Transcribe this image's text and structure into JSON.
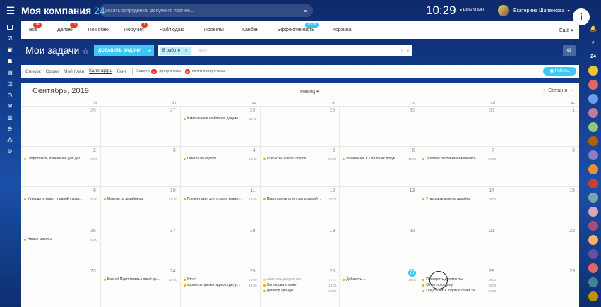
{
  "header": {
    "company": "Моя компания",
    "company_num": "24",
    "search_placeholder": "искать сотрудника, документ, прочее...",
    "time": "10:29",
    "work_status": "РАБОТАЮ",
    "user_name": "Екатерина Шапенкова"
  },
  "nav": {
    "items": [
      {
        "label": "Все",
        "badge": "14"
      },
      {
        "label": "Делаю",
        "badge": "11"
      },
      {
        "label": "Помогаю",
        "badge": ""
      },
      {
        "label": "Поручил",
        "badge": "1"
      },
      {
        "label": "Наблюдаю",
        "badge": ""
      },
      {
        "label": "Проекты",
        "badge": ""
      },
      {
        "label": "Канбан",
        "badge": ""
      },
      {
        "label": "Эффективность",
        "badge": "100%"
      },
      {
        "label": "Корзина",
        "badge": ""
      }
    ],
    "more": "Ещё"
  },
  "page": {
    "title": "Мои задачи",
    "add_task": "ДОБАВИТЬ ЗАДАЧУ",
    "filter_chip": "В работе",
    "filter_placeholder": "поиск"
  },
  "views": {
    "items": [
      "Список",
      "Сроки",
      "Мой план",
      "Календарь",
      "Гант"
    ],
    "active": "Календарь",
    "tasks_label": "Задачи",
    "overdue_count": "11",
    "overdue_label": "просрочены",
    "almost_count": "8",
    "almost_label": "почти просрочены",
    "robots": "Роботы"
  },
  "calendar": {
    "month": "Сентябрь, 2019",
    "mode": "Месяц",
    "today": "Сегодня",
    "days_of_week": [
      "пн",
      "вт",
      "ср",
      "чт",
      "пт",
      "сб",
      "вс"
    ],
    "weeks": [
      {
        "days": [
          {
            "num": "26",
            "other": true,
            "events": []
          },
          {
            "num": "27",
            "other": true,
            "events": []
          },
          {
            "num": "28",
            "other": true,
            "events": [
              {
                "text": "Изменения в шаблонах докуме...",
                "time": "11:00"
              }
            ]
          },
          {
            "num": "29",
            "other": true,
            "events": []
          },
          {
            "num": "30",
            "other": true,
            "events": []
          },
          {
            "num": "31",
            "other": true,
            "events": []
          },
          {
            "num": "1",
            "other": false,
            "events": []
          }
        ]
      },
      {
        "days": [
          {
            "num": "2",
            "other": false,
            "events": [
              {
                "text": "Подготовить изменения для дог...",
                "time": "19:00"
              }
            ]
          },
          {
            "num": "3",
            "other": false,
            "events": []
          },
          {
            "num": "4",
            "other": false,
            "events": [
              {
                "text": "Отчеты по отделу",
                "time": "16:30"
              }
            ]
          },
          {
            "num": "5",
            "other": false,
            "events": [
              {
                "text": "Открытие нового офиса",
                "time": "19:00"
              }
            ]
          },
          {
            "num": "6",
            "other": false,
            "events": [
              {
                "text": "Изменения в шаблонах докум...",
                "time": "11:00"
              }
            ]
          },
          {
            "num": "7",
            "other": false,
            "events": [
              {
                "text": "Условия поставки изменились",
                "time": "19:00"
              }
            ]
          },
          {
            "num": "8",
            "other": false,
            "events": []
          }
        ]
      },
      {
        "days": [
          {
            "num": "9",
            "other": false,
            "events": [
              {
                "text": "Утвердить макет главной стран...",
                "time": "19:00"
              }
            ]
          },
          {
            "num": "10",
            "other": false,
            "events": [
              {
                "text": "Макеты от дизайнера",
                "time": "19:00"
              }
            ]
          },
          {
            "num": "11",
            "other": false,
            "events": [
              {
                "text": "Презентация для отдела марке...",
                "time": "19:00"
              }
            ]
          },
          {
            "num": "12",
            "other": false,
            "events": [
              {
                "text": "Подготовить отчет за прошлый ...",
                "time": "19:00"
              }
            ]
          },
          {
            "num": "13",
            "other": false,
            "events": []
          },
          {
            "num": "14",
            "other": false,
            "events": [
              {
                "text": "Утвердить макеты дизайна",
                "time": "19:00"
              }
            ]
          },
          {
            "num": "15",
            "other": false,
            "events": []
          }
        ]
      },
      {
        "days": [
          {
            "num": "16",
            "other": false,
            "events": [
              {
                "text": "Новые макеты",
                "time": "19:00"
              }
            ]
          },
          {
            "num": "17",
            "other": false,
            "events": []
          },
          {
            "num": "18",
            "other": false,
            "events": []
          },
          {
            "num": "19",
            "other": false,
            "events": []
          },
          {
            "num": "20",
            "other": false,
            "events": []
          },
          {
            "num": "21",
            "other": false,
            "events": []
          },
          {
            "num": "22",
            "other": false,
            "events": []
          }
        ]
      },
      {
        "days": [
          {
            "num": "23",
            "other": false,
            "events": []
          },
          {
            "num": "24",
            "other": false,
            "events": [
              {
                "text": "Важно! Подготовить новый до...",
                "time": "19:00"
              }
            ]
          },
          {
            "num": "25",
            "other": false,
            "events": [
              {
                "text": "Отчет",
                "time": "19:00"
              },
              {
                "text": "провести презентацию отделу ...",
                "time": "19:00"
              }
            ]
          },
          {
            "num": "26",
            "other": false,
            "events": [
              {
                "text": "изменить документы",
                "time": "19:00",
                "faded": true
              },
              {
                "text": "Согласовать макет",
                "time": "19:00"
              },
              {
                "text": "Договор аренды",
                "time": "19:00"
              }
            ]
          },
          {
            "num": "27",
            "other": false,
            "today": true,
            "events": [
              {
                "text": "Добавить ...",
                "time": "19:00"
              }
            ]
          },
          {
            "num": "28",
            "other": false,
            "events": [
              {
                "text": "Проверить документы",
                "time": "19:00"
              },
              {
                "text": "Отчет по отделу",
                "time": "19:00"
              },
              {
                "text": "Подготовить годовой отчет за ...",
                "time": "19:00"
              }
            ]
          },
          {
            "num": "29",
            "other": false,
            "events": []
          }
        ]
      }
    ]
  },
  "right_rail": {
    "counter": "24"
  }
}
